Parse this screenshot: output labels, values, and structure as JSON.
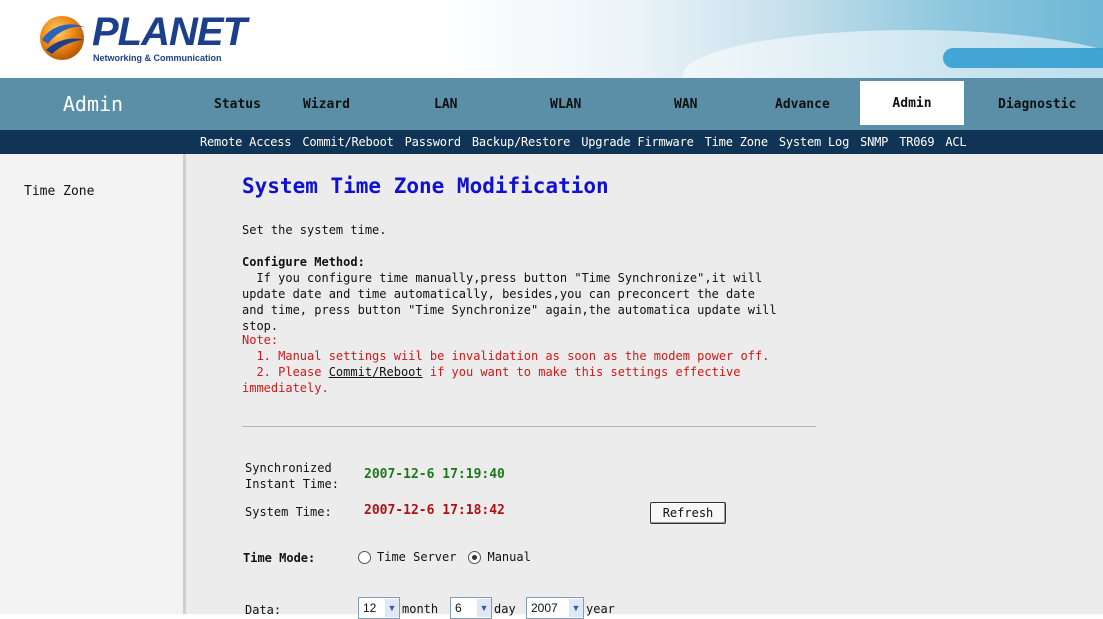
{
  "brand": {
    "name": "PLANET",
    "tagline": "Networking & Communication"
  },
  "nav": {
    "section_title": "Admin",
    "tabs": [
      {
        "label": "Status",
        "active": false
      },
      {
        "label": "Wizard",
        "active": false
      },
      {
        "label": "LAN",
        "active": false
      },
      {
        "label": "WLAN",
        "active": false
      },
      {
        "label": "WAN",
        "active": false
      },
      {
        "label": "Advance",
        "active": false
      },
      {
        "label": "Admin",
        "active": true
      },
      {
        "label": "Diagnostic",
        "active": false
      }
    ],
    "subitems": [
      "Remote Access",
      "Commit/Reboot",
      "Password",
      "Backup/Restore",
      "Upgrade Firmware",
      "Time Zone",
      "System Log",
      "SNMP",
      "TR069",
      "ACL"
    ]
  },
  "sidebar": {
    "items": [
      {
        "label": "Time Zone"
      }
    ]
  },
  "page": {
    "title": "System Time Zone Modification",
    "intro": "Set the system time.",
    "configure_heading": "Configure Method:",
    "configure_body": "  If you configure time manually,press button \"Time Synchronize\",it will\nupdate date and time automatically, besides,you can preconcert the date\nand time, press button \"Time Synchronize\" again,the automatica update will\nstop.",
    "note_heading": "Note:",
    "note_line1": "  1. Manual settings wiil be invalidation as soon as the modem power off.",
    "note_line2_pre": "  2. Please ",
    "note_link": "Commit/Reboot",
    "note_line2_post": " if you want to make this settings effective",
    "note_line3": "immediately."
  },
  "time": {
    "sync_label_1": "Synchronized",
    "sync_label_2": "Instant Time:",
    "sync_value": "2007-12-6 17:19:40",
    "system_label": "System Time:",
    "system_value": "2007-12-6 17:18:42",
    "refresh_label": "Refresh"
  },
  "time_mode": {
    "label": "Time Mode:",
    "options": [
      {
        "label": "Time Server",
        "checked": false
      },
      {
        "label": "Manual",
        "checked": true
      }
    ]
  },
  "date": {
    "label": "Data:",
    "month": "12",
    "month_unit": "month",
    "day": "6",
    "day_unit": "day",
    "year": "2007",
    "year_unit": "year"
  },
  "colors": {
    "nav_bg": "#5b8fa8",
    "subnav_bg": "#0f3455",
    "title": "#1010d0",
    "note": "#d01818",
    "sync_value": "#1a7a1a",
    "system_value": "#b01010"
  }
}
